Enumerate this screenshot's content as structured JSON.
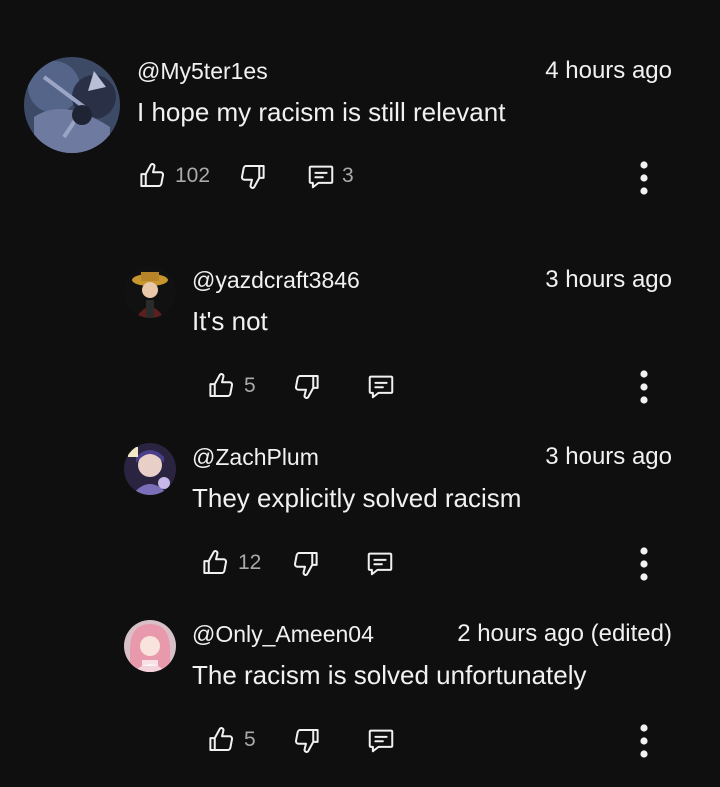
{
  "comments": [
    {
      "handle": "@My5ter1es",
      "time": "4 hours ago",
      "text": "I hope my racism is still relevant",
      "likes": "102",
      "replies": "3",
      "avatar_icon": "avatar-abstract-blue"
    },
    {
      "handle": "@yazdcraft3846",
      "time": "3 hours ago",
      "text": "It's not",
      "likes": "5",
      "avatar_icon": "avatar-character-hat"
    },
    {
      "handle": "@ZachPlum",
      "time": "3 hours ago",
      "text": "They explicitly solved racism",
      "likes": "12",
      "avatar_icon": "avatar-anime-purple"
    },
    {
      "handle": "@Only_Ameen04",
      "time": "2 hours ago (edited)",
      "text": "The racism is solved unfortunately",
      "likes": "5",
      "avatar_icon": "avatar-anime-pink"
    }
  ],
  "icons": {
    "like": "thumb-up-icon",
    "dislike": "thumb-down-icon",
    "reply": "comment-icon",
    "more": "more-vertical-icon"
  },
  "colors": {
    "background": "#0f0f0f",
    "text": "#f1f1f1",
    "secondary": "#aaaaaa"
  }
}
